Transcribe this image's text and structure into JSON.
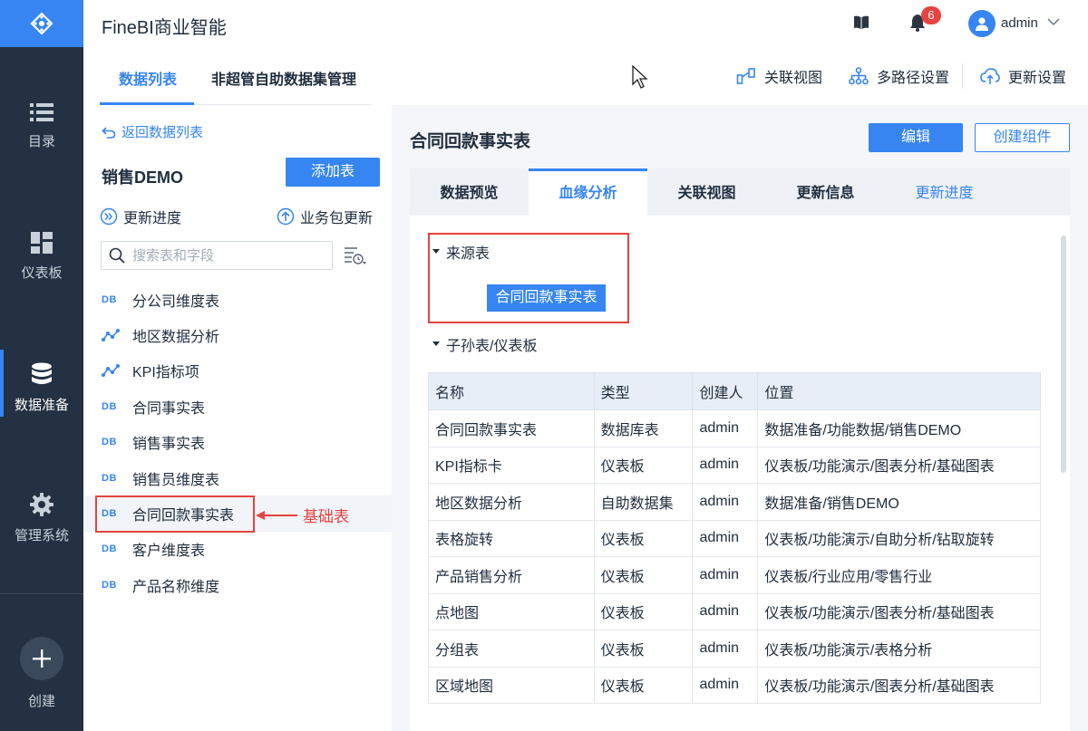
{
  "app": {
    "title": "FineBI商业智能"
  },
  "nav": {
    "items": [
      {
        "label": "目录",
        "icon": "list-icon"
      },
      {
        "label": "仪表板",
        "icon": "dashboard-icon"
      },
      {
        "label": "数据准备",
        "icon": "database-icon"
      },
      {
        "label": "管理系统",
        "icon": "gear-icon"
      }
    ],
    "create_label": "创建"
  },
  "header": {
    "badge_count": "6",
    "user": "admin"
  },
  "top_tabs": [
    "数据列表",
    "非超管自助数据集管理"
  ],
  "top_actions": {
    "relation_view": "关联视图",
    "multipath": "多路径设置",
    "update_settings": "更新设置"
  },
  "left": {
    "back_link": "返回数据列表",
    "package_title": "销售DEMO",
    "add_table": "添加表",
    "update_progress": "更新进度",
    "package_update": "业务包更新",
    "search_placeholder": "搜索表和字段",
    "db_tag": "DB",
    "tables": [
      {
        "label": "分公司维度表",
        "type": "db"
      },
      {
        "label": "地区数据分析",
        "type": "self"
      },
      {
        "label": "KPI指标项",
        "type": "self"
      },
      {
        "label": "合同事实表",
        "type": "db"
      },
      {
        "label": "销售事实表",
        "type": "db"
      },
      {
        "label": "销售员维度表",
        "type": "db"
      },
      {
        "label": "合同回款事实表",
        "type": "db"
      },
      {
        "label": "客户维度表",
        "type": "db"
      },
      {
        "label": "产品名称维度",
        "type": "db"
      }
    ],
    "annotation": "基础表"
  },
  "right": {
    "title": "合同回款事实表",
    "edit": "编辑",
    "create_component": "创建组件",
    "tabs": [
      "数据预览",
      "血缘分析",
      "关联视图",
      "更新信息",
      "更新进度"
    ],
    "source_section": "来源表",
    "source_table": "合同回款事实表",
    "child_section": "子孙表/仪表板",
    "columns": [
      "名称",
      "类型",
      "创建人",
      "位置"
    ],
    "rows": [
      [
        "合同回款事实表",
        "数据库表",
        "admin",
        "数据准备/功能数据/销售DEMO"
      ],
      [
        "KPI指标卡",
        "仪表板",
        "admin",
        "仪表板/功能演示/图表分析/基础图表"
      ],
      [
        "地区数据分析",
        "自助数据集",
        "admin",
        "数据准备/销售DEMO"
      ],
      [
        "表格旋转",
        "仪表板",
        "admin",
        "仪表板/功能演示/自助分析/钻取旋转"
      ],
      [
        "产品销售分析",
        "仪表板",
        "admin",
        "仪表板/行业应用/零售行业"
      ],
      [
        "点地图",
        "仪表板",
        "admin",
        "仪表板/功能演示/图表分析/基础图表"
      ],
      [
        "分组表",
        "仪表板",
        "admin",
        "仪表板/功能演示/表格分析"
      ],
      [
        "区域地图",
        "仪表板",
        "admin",
        "仪表板/功能演示/图表分析/基础图表"
      ]
    ]
  },
  "colors": {
    "accent": "#3685f2",
    "nav_bg": "#233142",
    "highlight": "#e64340"
  }
}
